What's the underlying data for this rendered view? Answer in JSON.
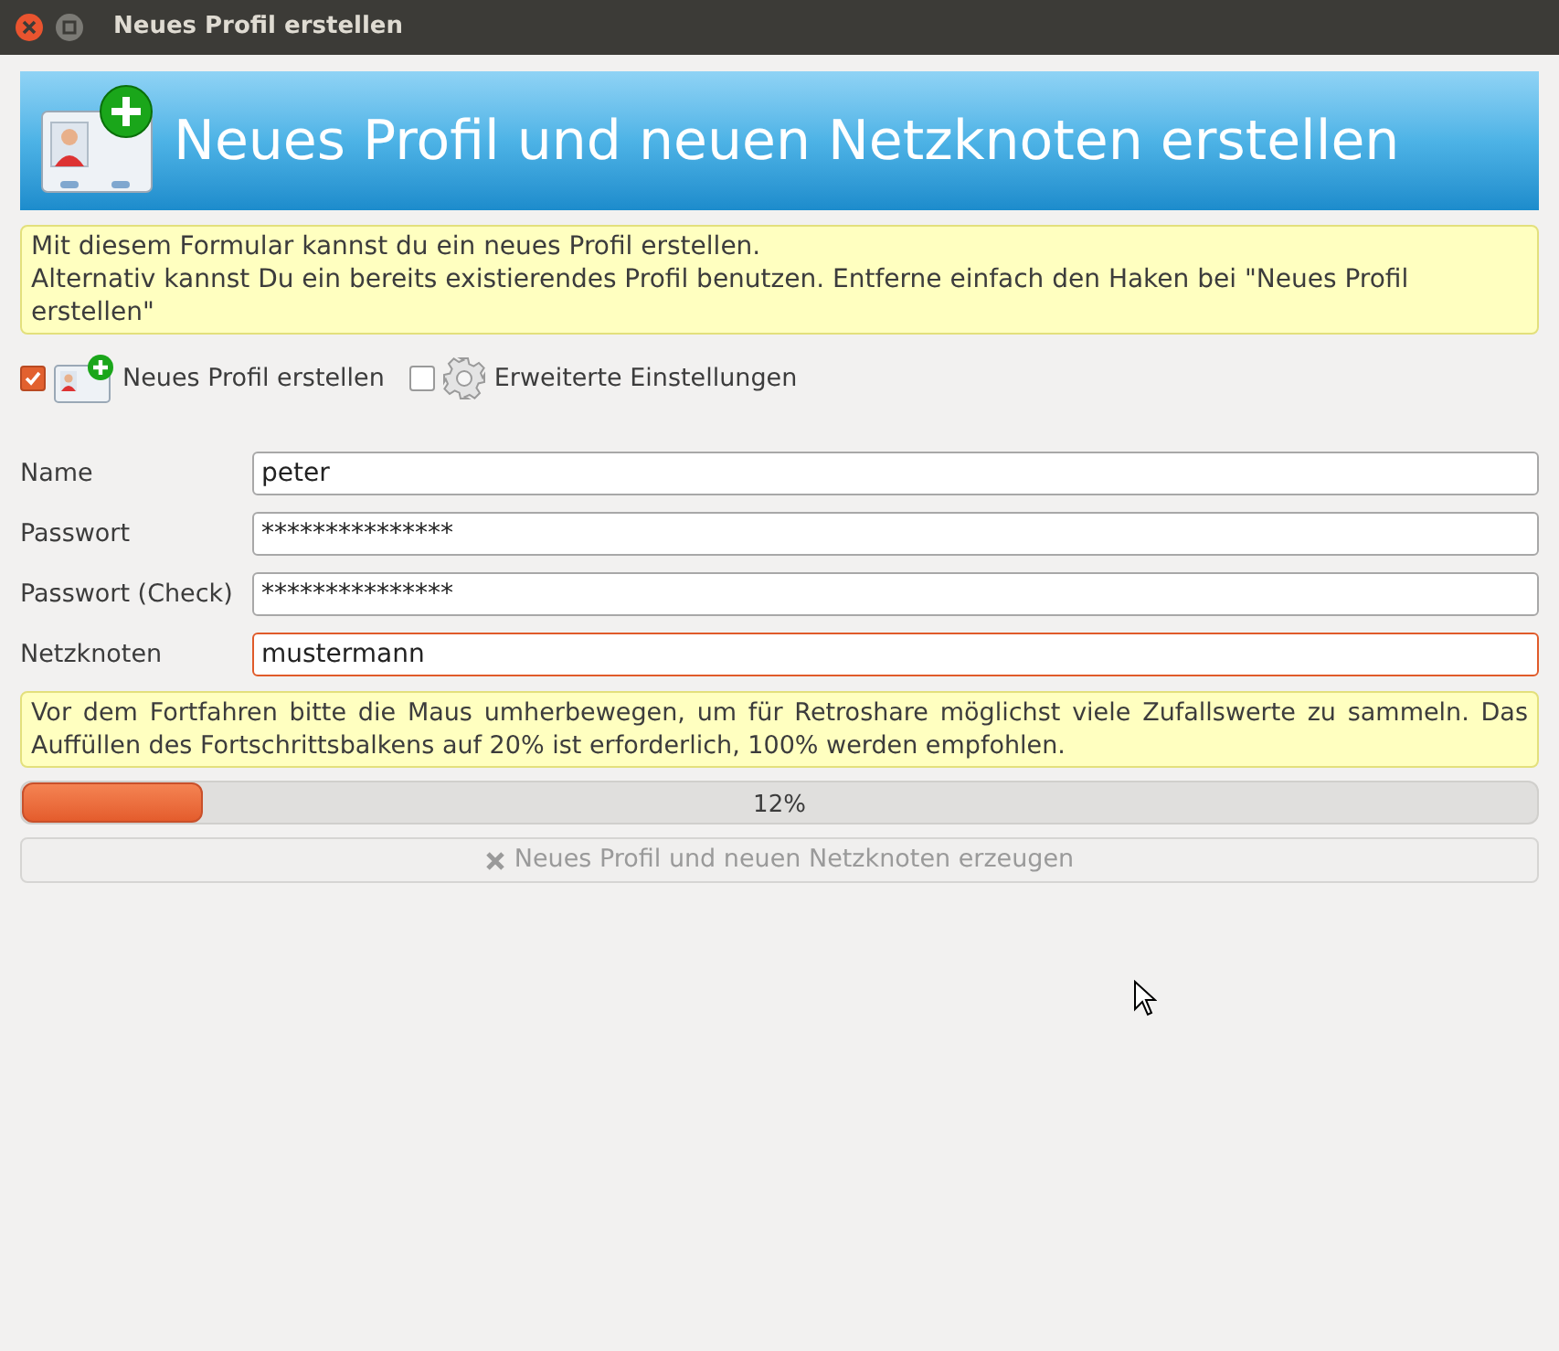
{
  "window": {
    "title": "Neues Profil erstellen"
  },
  "header": {
    "title": "Neues Profil und neuen Netzknoten erstellen"
  },
  "info": {
    "lines": [
      "Mit diesem Formular kannst du ein neues Profil erstellen.",
      "Alternativ kannst Du ein bereits existierendes Profil benutzen. Entferne einfach den Haken bei \"Neues Profil erstellen\""
    ]
  },
  "options": [
    {
      "kind": "profile",
      "label": "Neues Profil erstellen",
      "checked": true
    },
    {
      "kind": "settings",
      "label": "Erweiterte Einstellungen",
      "checked": false
    }
  ],
  "fields": [
    {
      "label": "Name",
      "value": "peter",
      "focused": false
    },
    {
      "label": "Passwort",
      "value": "***************",
      "focused": false
    },
    {
      "label": "Passwort (Check)",
      "value": "***************",
      "focused": false
    },
    {
      "label": "Netzknoten",
      "value": "mustermann",
      "focused": true
    }
  ],
  "note": "Vor dem Fortfahren bitte die Maus umherbewegen, um für Retroshare möglichst viele Zufallswerte zu sammeln. Das Auffüllen des Fortschrittsbalkens auf 20% ist erforderlich, 100% werden empfohlen.",
  "progress": {
    "level": 0.12,
    "reading": "12%"
  },
  "create_button": {
    "label": "Neues Profil und neuen Netzknoten erzeugen",
    "disabled": true
  }
}
